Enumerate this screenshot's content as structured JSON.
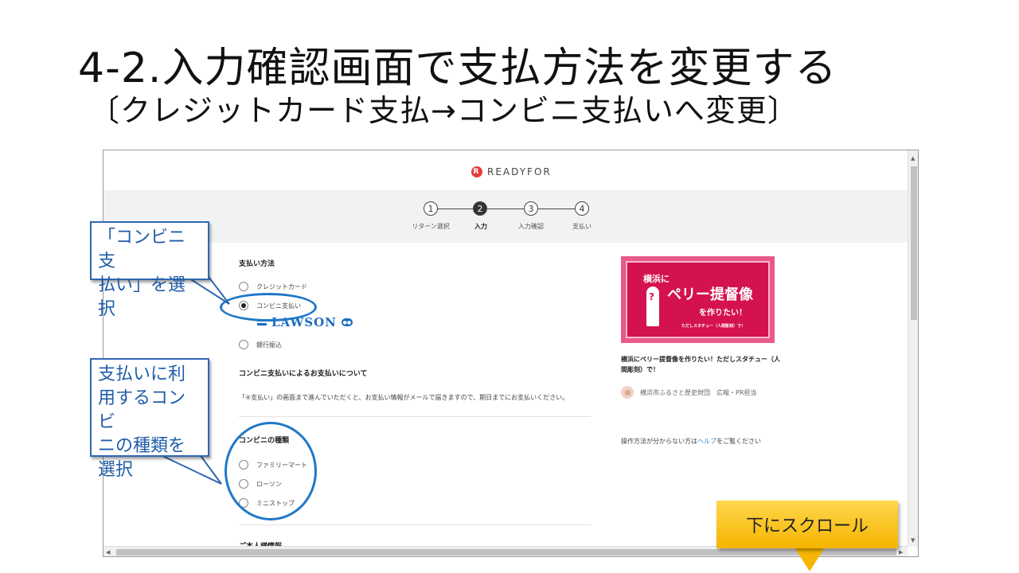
{
  "slide": {
    "title": "4-2.入力確認画面で支払方法を変更する",
    "subtitle": "〔クレジットカード支払→コンビニ支払いへ変更〕"
  },
  "site": {
    "logo_text": "READYFOR",
    "logo_icon": "readyfor-logo-icon"
  },
  "steps": [
    {
      "number": "1",
      "label": "リターン選択",
      "active": false
    },
    {
      "number": "2",
      "label": "入力",
      "active": true
    },
    {
      "number": "3",
      "label": "入力確認",
      "active": false
    },
    {
      "number": "4",
      "label": "支払い",
      "active": false
    }
  ],
  "payment": {
    "heading": "支払い方法",
    "options": [
      {
        "label": "クレジットカード",
        "checked": false
      },
      {
        "label": "コンビニ支払い",
        "checked": true
      },
      {
        "label": "銀行振込",
        "checked": false
      }
    ],
    "lawson_text": "LAWSON"
  },
  "conveni_info": {
    "heading": "コンビニ支払いによるお支払いについて",
    "text": "「④支払い」の画面まで進んでいただくと、お支払い情報がメールで届きますので、期日までにお支払いください。"
  },
  "conveni_type": {
    "heading": "コンビニの種類",
    "options": [
      {
        "label": "ファミリーマート",
        "checked": false
      },
      {
        "label": "ローソン",
        "checked": false
      },
      {
        "label": "ミニストップ",
        "checked": false
      }
    ]
  },
  "next_section_heading": "ご本人様情報",
  "project": {
    "image_text_1": "横浜に",
    "image_text_2": "ペリー提督像",
    "image_text_3": "を作りたい！",
    "image_text_4": "ただしスタチュー（人間彫刻）で！",
    "title": "横浜にペリー提督像を作りたい！ただしスタチュー（人間彫刻）で！",
    "owner": "横浜市ふるさと歴史財団　広報・PR担当"
  },
  "help": {
    "prefix": "操作方法が分からない方は",
    "link": "ヘルプ",
    "suffix": "をご覧ください"
  },
  "annotations": {
    "callout_1": [
      "「コンビニ支",
      "払い」を選択"
    ],
    "callout_2": [
      "支払いに利",
      "用するコンビ",
      "ニの種類を",
      "選択"
    ],
    "scroll_note": "下にスクロール"
  },
  "colors": {
    "annotation_blue": "#2f67b1",
    "note_yellow": "#ffc000",
    "lawson_blue": "#1b6bc2",
    "project_pink": "#d4124f"
  }
}
